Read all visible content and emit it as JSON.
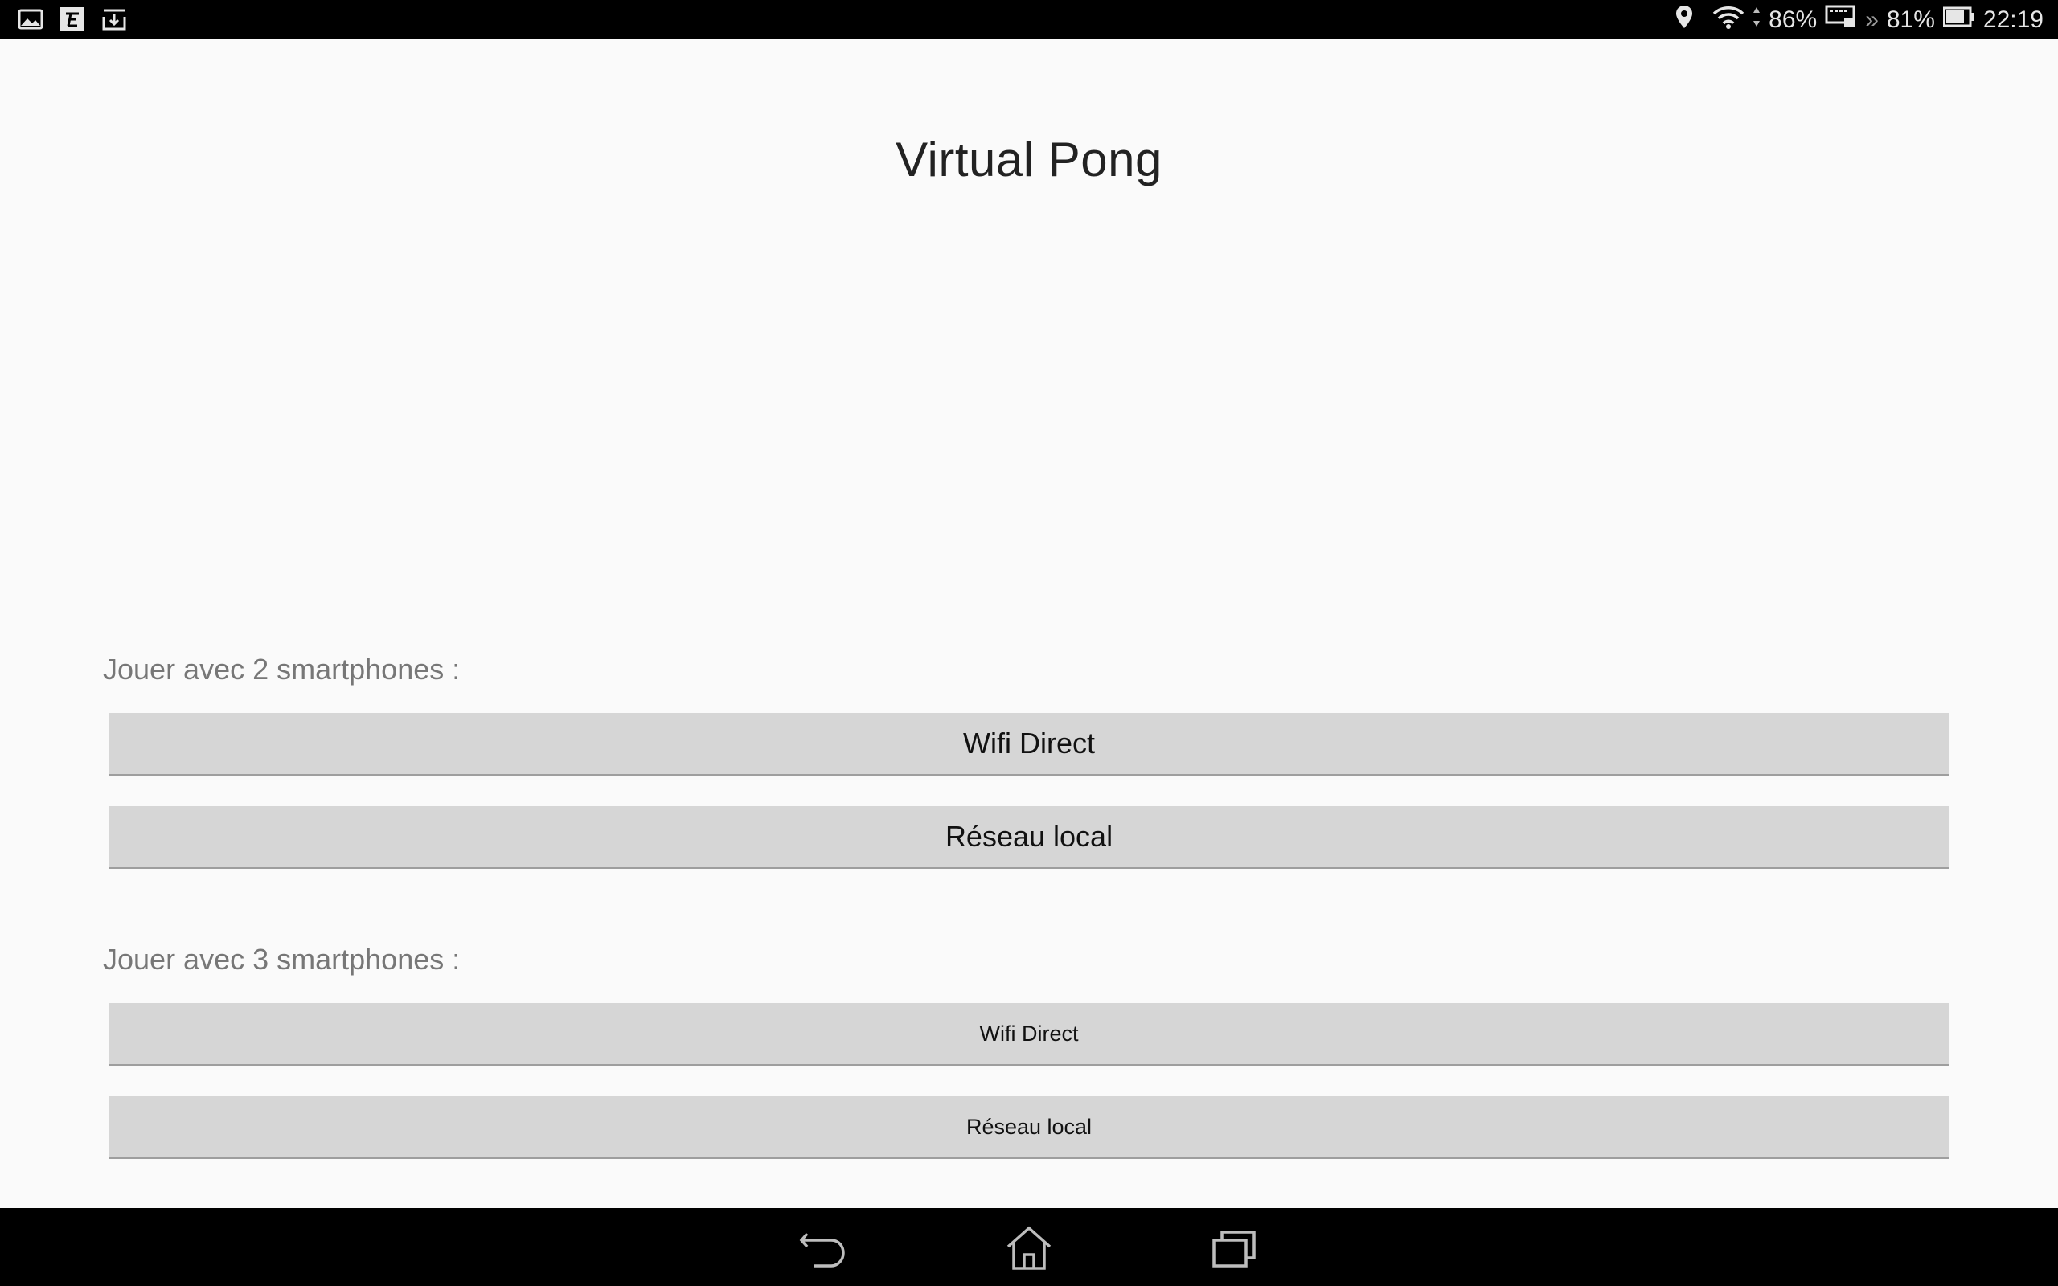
{
  "status_bar": {
    "notification_icons": [
      "image-icon",
      "news-icon",
      "download-icon"
    ],
    "wifi_signal": "86%",
    "battery_secondary": "81%",
    "time": "22:19"
  },
  "app": {
    "title": "Virtual Pong"
  },
  "sections": [
    {
      "label": "Jouer avec 2 smartphones :",
      "buttons": [
        "Wifi Direct",
        "Réseau local"
      ]
    },
    {
      "label": "Jouer avec 3 smartphones :",
      "buttons": [
        "Wifi Direct",
        "Réseau local"
      ]
    }
  ],
  "nav_bar": {
    "icons": [
      "back-icon",
      "home-icon",
      "recents-icon"
    ]
  },
  "colors": {
    "background": "#fafafa",
    "button": "#d6d6d6",
    "bars": "#000000"
  }
}
